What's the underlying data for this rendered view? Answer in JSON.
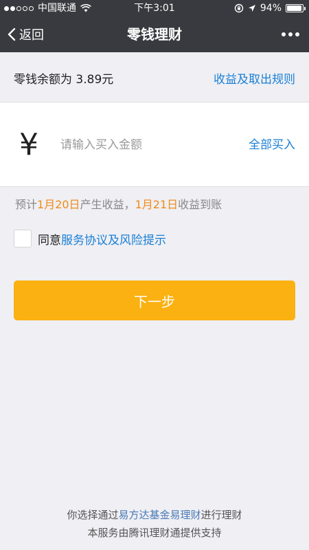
{
  "status_bar": {
    "carrier": "中国联通",
    "time": "下午3:01",
    "battery": "94%",
    "battery_level": 0.94
  },
  "nav": {
    "back_label": "返回",
    "title": "零钱理财"
  },
  "balance": {
    "text": "零钱余额为 3.89元",
    "rules_link": "收益及取出规则"
  },
  "input": {
    "currency_symbol": "¥",
    "placeholder": "请输入买入金额",
    "value": "",
    "buy_all": "全部买入"
  },
  "earning": {
    "prefix": "预计",
    "date1": "1月20日",
    "middle": "产生收益，",
    "date2": "1月21日",
    "suffix": "收益到账"
  },
  "agreement": {
    "checked": false,
    "text": "同意",
    "link": "服务协议及风险提示"
  },
  "next_button": "下一步",
  "footer": {
    "line1_prefix": "你选择通过",
    "line1_link": "易方达基金易理财",
    "line1_suffix": "进行理财",
    "line2": "本服务由腾讯理财通提供支持"
  },
  "colors": {
    "nav_bg": "#393a3f",
    "link": "#1a7fd4",
    "accent_orange": "#f08a14",
    "button": "#fbb111"
  }
}
